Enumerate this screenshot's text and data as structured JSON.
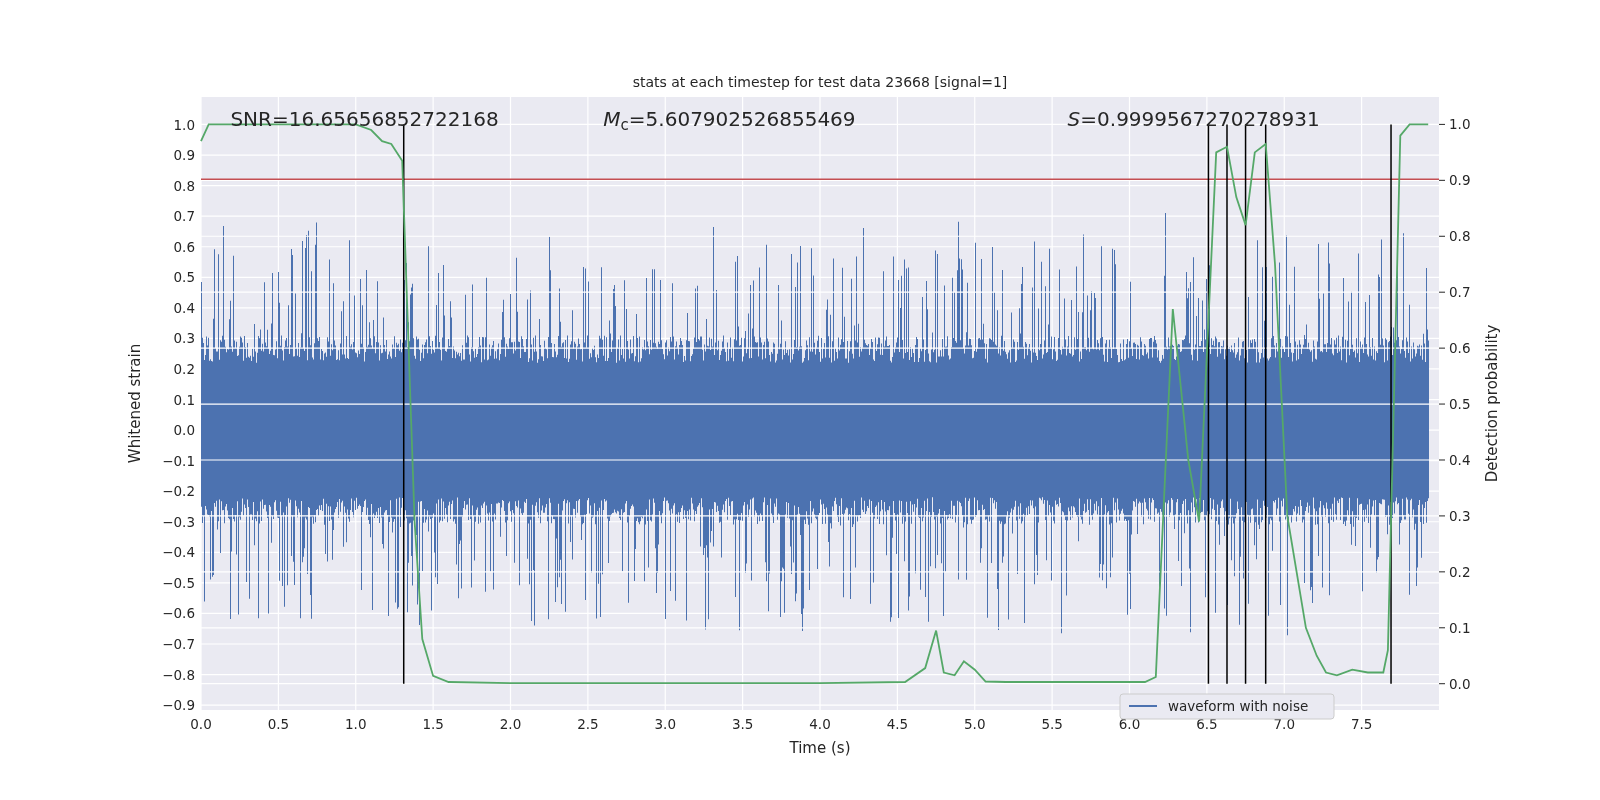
{
  "figure": {
    "stats": [
      "SNR=16.65656852722168",
      "*M*$_{c}$=5.607902526855469",
      "*S*=0.9999567270278931"
    ],
    "left_axis": {
      "label": "Whitened strain",
      "ticks": [
        "1.0",
        "0.9",
        "0.8",
        "0.7",
        "0.6",
        "0.5",
        "0.4",
        "0.3",
        "0.2",
        "0.1",
        "0.0",
        "−0.1",
        "−0.2",
        "−0.3",
        "−0.4",
        "−0.5",
        "−0.6",
        "−0.7",
        "−0.8",
        "−0.9"
      ]
    },
    "legend": [
      {
        "label": "waveform with noise",
        "color": "#4c72b0"
      }
    ],
    "chart_data": {
      "type": "line",
      "title": "stats at each timestep for test data 23668 [signal=1]",
      "xlabel": "Time (s)",
      "ylabel": "Detection probability",
      "x": [
        0,
        0.05,
        0.1,
        0.5,
        1.0,
        1.1,
        1.17,
        1.23,
        1.3,
        1.38,
        1.43,
        1.5,
        1.6,
        2.0,
        3.0,
        4.0,
        4.55,
        4.68,
        4.75,
        4.8,
        4.87,
        4.93,
        5.0,
        5.07,
        5.2,
        6.1,
        6.17,
        6.28,
        6.38,
        6.45,
        6.56,
        6.63,
        6.69,
        6.75,
        6.81,
        6.88,
        6.94,
        7.02,
        7.08,
        7.14,
        7.21,
        7.27,
        7.34,
        7.44,
        7.54,
        7.64,
        7.67,
        7.75,
        7.81,
        7.93
      ],
      "series": [
        {
          "color": "#55a868",
          "values": [
            0.97,
            1.0,
            1.0,
            1.0,
            1.0,
            0.99,
            0.97,
            0.965,
            0.935,
            0.29,
            0.08,
            0.014,
            0.003,
            0.001,
            0.001,
            0.001,
            0.003,
            0.028,
            0.095,
            0.02,
            0.015,
            0.04,
            0.025,
            0.004,
            0.003,
            0.003,
            0.012,
            0.67,
            0.4,
            0.29,
            0.95,
            0.96,
            0.87,
            0.82,
            0.95,
            0.965,
            0.75,
            0.3,
            0.2,
            0.1,
            0.05,
            0.02,
            0.015,
            0.025,
            0.02,
            0.02,
            0.06,
            0.98,
            1.0,
            1.0
          ]
        }
      ],
      "grid": true,
      "xlim": [
        0,
        8
      ],
      "ylim": [
        -0.047,
        1.049
      ],
      "xticks": [
        {
          "value": 0,
          "label": "0.0"
        },
        {
          "value": 0.5,
          "label": "0.5"
        },
        {
          "value": 1,
          "label": "1.0"
        },
        {
          "value": 1.5,
          "label": "1.5"
        },
        {
          "value": 2,
          "label": "2.0"
        },
        {
          "value": 2.5,
          "label": "2.5"
        },
        {
          "value": 3,
          "label": "3.0"
        },
        {
          "value": 3.5,
          "label": "3.5"
        },
        {
          "value": 4,
          "label": "4.0"
        },
        {
          "value": 4.5,
          "label": "4.5"
        },
        {
          "value": 5,
          "label": "5.0"
        },
        {
          "value": 5.5,
          "label": "5.5"
        },
        {
          "value": 6,
          "label": "6.0"
        },
        {
          "value": 6.5,
          "label": "6.5"
        },
        {
          "value": 7,
          "label": "7.0"
        },
        {
          "value": 7.5,
          "label": "7.5"
        }
      ],
      "yticks": [
        {
          "value": 0,
          "label": "0.0"
        },
        {
          "value": 0.1,
          "label": "0.1"
        },
        {
          "value": 0.2,
          "label": "0.2"
        },
        {
          "value": 0.3,
          "label": "0.3"
        },
        {
          "value": 0.4,
          "label": "0.4"
        },
        {
          "value": 0.5,
          "label": "0.5"
        },
        {
          "value": 0.6,
          "label": "0.6"
        },
        {
          "value": 0.7,
          "label": "0.7"
        },
        {
          "value": 0.8,
          "label": "0.8"
        },
        {
          "value": 0.9,
          "label": "0.9"
        },
        {
          "value": 1,
          "label": "1.0"
        }
      ],
      "ref_lines": [
        {
          "axis": "y",
          "value": 0.902,
          "color": "#c44e52"
        },
        {
          "axis": "x",
          "value": 1.31,
          "color": "#000000"
        },
        {
          "axis": "x",
          "value": 6.51,
          "color": "#000000"
        },
        {
          "axis": "x",
          "value": 6.63,
          "color": "#000000"
        },
        {
          "axis": "x",
          "value": 6.75,
          "color": "#000000"
        },
        {
          "axis": "x",
          "value": 6.88,
          "color": "#000000"
        },
        {
          "axis": "x",
          "value": 7.69,
          "color": "#000000"
        }
      ]
    }
  }
}
